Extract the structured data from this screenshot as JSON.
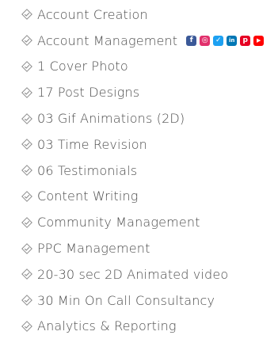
{
  "features": [
    {
      "label": "Account Creation"
    },
    {
      "label": "Account Management"
    },
    {
      "label": "1 Cover Photo"
    },
    {
      "label": "17 Post Designs"
    },
    {
      "label": "03 Gif Animations (2D)"
    },
    {
      "label": "03 Time Revision"
    },
    {
      "label": "06 Testimonials"
    },
    {
      "label": "Content Writing"
    },
    {
      "label": "Community Management"
    },
    {
      "label": "PPC Management"
    },
    {
      "label": "20-30 sec 2D Animated video"
    },
    {
      "label": "30 Min On Call Consultancy"
    },
    {
      "label": "Analytics & Reporting"
    }
  ],
  "social_icons": [
    {
      "icon": "facebook-icon",
      "color": "#3b5998",
      "glyph": "f"
    },
    {
      "icon": "instagram-icon",
      "color": "#e1306c",
      "glyph": "◎"
    },
    {
      "icon": "twitter-icon",
      "color": "#1da1f2",
      "glyph": "✓"
    },
    {
      "icon": "linkedin-icon",
      "color": "#0077b5",
      "glyph": "in"
    },
    {
      "icon": "pinterest-icon",
      "color": "#e60023",
      "glyph": "p"
    },
    {
      "icon": "youtube-icon",
      "color": "#ff0000",
      "glyph": "▶"
    }
  ],
  "colors": {
    "text": "#4b4b4b",
    "check": "#8c8c8c"
  }
}
